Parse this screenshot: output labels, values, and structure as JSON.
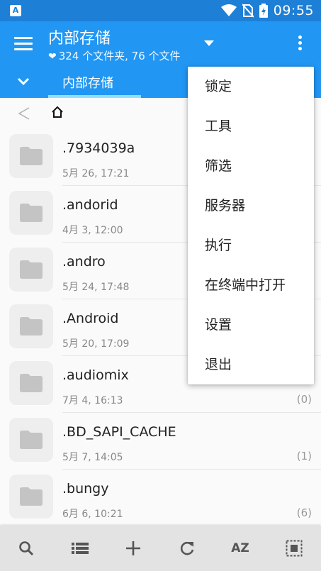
{
  "status_bar": {
    "time": "09:55",
    "icons": [
      "app-icon",
      "wifi-icon",
      "no-sim-icon",
      "battery-charging-icon"
    ]
  },
  "header": {
    "title": "内部存储",
    "subtitle": "324 个文件夹, 76 个文件",
    "tab_label": "内部存储"
  },
  "menu": {
    "items": [
      "锁定",
      "工具",
      "筛选",
      "服务器",
      "执行",
      "在终端中打开",
      "设置",
      "退出"
    ]
  },
  "files": [
    {
      "name": ".7934039a",
      "date": "5月 26, 17:21",
      "count": ""
    },
    {
      "name": ".andorid",
      "date": "4月 3, 12:00",
      "count": ""
    },
    {
      "name": ".andro",
      "date": "5月 24, 17:48",
      "count": ""
    },
    {
      "name": ".Android",
      "date": "5月 20, 17:09",
      "count": ""
    },
    {
      "name": ".audiomix",
      "date": "7月 4, 16:13",
      "count": "(0)"
    },
    {
      "name": ".BD_SAPI_CACHE",
      "date": "5月 7, 14:05",
      "count": "(1)"
    },
    {
      "name": ".bungy",
      "date": "6月 6, 10:21",
      "count": "(6)"
    }
  ],
  "bottom_bar": {
    "sort_label": "AZ",
    "icons": [
      "search-icon",
      "list-view-icon",
      "add-icon",
      "refresh-icon",
      "sort-az-icon",
      "select-all-icon"
    ]
  },
  "colors": {
    "status_bar": "#1e7fd6",
    "app_bar": "#2196f3",
    "tab_indicator": "#8ee0ff"
  }
}
